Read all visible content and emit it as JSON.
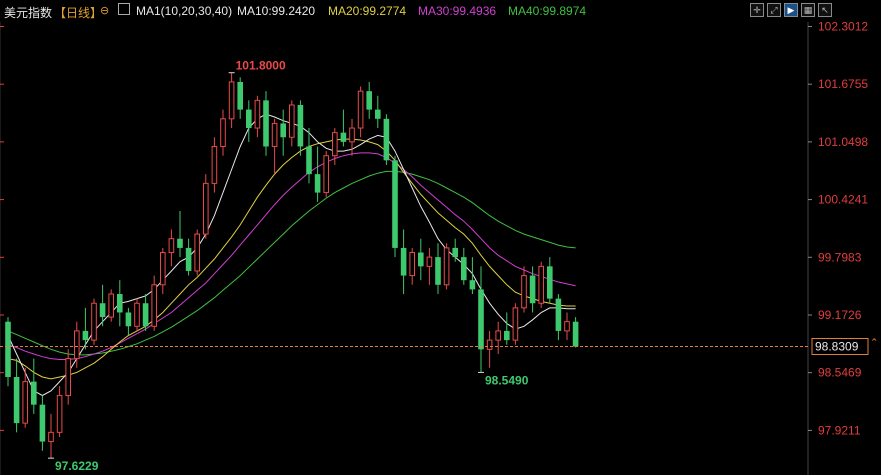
{
  "header": {
    "title": "美元指数",
    "period": "【日线】",
    "ma_group": "MA1(10,20,30,40)",
    "ma10": "MA10:99.2420",
    "ma20": "MA20:99.2774",
    "ma30": "MA30:99.4936",
    "ma40": "MA40:99.8974"
  },
  "colors": {
    "up": "#e84a4a",
    "down": "#3ec96e",
    "ma10": "#e8e8e8",
    "ma20": "#e0d040",
    "ma30": "#d040d0",
    "ma40": "#40c040",
    "current_line": "#e0803a"
  },
  "toolbar": {
    "icons": [
      "crosshair-icon",
      "expand-icon",
      "play-icon",
      "layout-icon",
      "cursor-icon"
    ]
  },
  "chart_data": {
    "type": "candlestick",
    "y_axis_labels": [
      "102.3012",
      "101.6755",
      "101.0498",
      "100.4241",
      "99.7983",
      "99.1726",
      "98.5469",
      "97.9211"
    ],
    "ylim": [
      97.6,
      102.35
    ],
    "current_price": "98.8309",
    "annotations": {
      "high": "101.8000",
      "low": "97.6229",
      "local_low": "98.5490"
    },
    "candles": [
      [
        99.1,
        99.15,
        98.4,
        98.5
      ],
      [
        98.5,
        98.7,
        97.9,
        98.0
      ],
      [
        98.0,
        98.6,
        97.95,
        98.45
      ],
      [
        98.45,
        98.7,
        98.1,
        98.2
      ],
      [
        98.2,
        98.3,
        97.7,
        97.8
      ],
      [
        97.8,
        98.1,
        97.62,
        97.9
      ],
      [
        97.9,
        98.4,
        97.85,
        98.3
      ],
      [
        98.3,
        98.8,
        98.2,
        98.7
      ],
      [
        98.7,
        99.1,
        98.6,
        99.0
      ],
      [
        99.0,
        99.25,
        98.8,
        98.9
      ],
      [
        98.9,
        99.35,
        98.85,
        99.3
      ],
      [
        99.3,
        99.5,
        99.05,
        99.15
      ],
      [
        99.15,
        99.45,
        99.1,
        99.4
      ],
      [
        99.4,
        99.55,
        99.05,
        99.2
      ],
      [
        99.2,
        99.25,
        98.95,
        99.05
      ],
      [
        99.05,
        99.35,
        99.0,
        99.3
      ],
      [
        99.3,
        99.4,
        99.0,
        99.05
      ],
      [
        99.05,
        99.6,
        99.0,
        99.5
      ],
      [
        99.5,
        99.9,
        99.4,
        99.85
      ],
      [
        99.85,
        100.1,
        99.7,
        100.0
      ],
      [
        100.0,
        100.3,
        99.8,
        99.9
      ],
      [
        99.9,
        100.0,
        99.6,
        99.65
      ],
      [
        99.65,
        100.1,
        99.6,
        100.05
      ],
      [
        100.05,
        100.7,
        100.0,
        100.6
      ],
      [
        100.6,
        101.1,
        100.5,
        101.0
      ],
      [
        101.0,
        101.4,
        100.9,
        101.3
      ],
      [
        101.3,
        101.8,
        101.2,
        101.7
      ],
      [
        101.7,
        101.75,
        101.3,
        101.4
      ],
      [
        101.4,
        101.5,
        101.05,
        101.2
      ],
      [
        101.2,
        101.55,
        101.1,
        101.5
      ],
      [
        101.5,
        101.6,
        100.9,
        101.0
      ],
      [
        101.0,
        101.3,
        100.7,
        101.25
      ],
      [
        101.25,
        101.4,
        100.9,
        101.1
      ],
      [
        101.1,
        101.5,
        101.0,
        101.45
      ],
      [
        101.45,
        101.5,
        100.9,
        101.0
      ],
      [
        101.0,
        101.2,
        100.6,
        100.7
      ],
      [
        100.7,
        101.0,
        100.4,
        100.5
      ],
      [
        100.5,
        100.95,
        100.45,
        100.9
      ],
      [
        100.9,
        101.2,
        100.8,
        101.15
      ],
      [
        101.15,
        101.4,
        101.0,
        101.05
      ],
      [
        101.05,
        101.3,
        100.9,
        101.2
      ],
      [
        101.2,
        101.65,
        101.1,
        101.6
      ],
      [
        101.6,
        101.7,
        101.3,
        101.4
      ],
      [
        101.4,
        101.55,
        101.2,
        101.3
      ],
      [
        101.3,
        101.35,
        100.8,
        100.85
      ],
      [
        100.85,
        100.9,
        99.8,
        99.9
      ],
      [
        99.9,
        100.1,
        99.4,
        99.6
      ],
      [
        99.6,
        99.9,
        99.5,
        99.85
      ],
      [
        99.85,
        100.0,
        99.55,
        99.7
      ],
      [
        99.7,
        99.9,
        99.5,
        99.8
      ],
      [
        99.8,
        99.95,
        99.4,
        99.5
      ],
      [
        99.5,
        99.95,
        99.45,
        99.9
      ],
      [
        99.9,
        100.0,
        99.75,
        99.8
      ],
      [
        99.8,
        99.9,
        99.5,
        99.55
      ],
      [
        99.55,
        99.8,
        99.4,
        99.45
      ],
      [
        99.45,
        99.7,
        98.55,
        98.8
      ],
      [
        98.8,
        99.0,
        98.6,
        98.9
      ],
      [
        98.9,
        99.1,
        98.75,
        99.0
      ],
      [
        99.0,
        99.2,
        98.85,
        98.9
      ],
      [
        98.9,
        99.3,
        98.85,
        99.25
      ],
      [
        99.25,
        99.7,
        99.2,
        99.6
      ],
      [
        99.6,
        99.7,
        99.2,
        99.3
      ],
      [
        99.3,
        99.75,
        99.25,
        99.7
      ],
      [
        99.7,
        99.8,
        99.3,
        99.35
      ],
      [
        99.35,
        99.4,
        98.9,
        99.0
      ],
      [
        99.0,
        99.2,
        98.9,
        99.1
      ],
      [
        99.1,
        99.15,
        98.82,
        98.83
      ]
    ],
    "ma10": [
      98.95,
      98.75,
      98.55,
      98.35,
      98.3,
      98.35,
      98.45,
      98.55,
      98.7,
      98.85,
      99.0,
      99.1,
      99.2,
      99.3,
      99.32,
      99.35,
      99.38,
      99.45,
      99.55,
      99.65,
      99.75,
      99.8,
      99.9,
      100.05,
      100.25,
      100.5,
      100.75,
      101.0,
      101.2,
      101.3,
      101.35,
      101.32,
      101.28,
      101.25,
      101.22,
      101.15,
      101.05,
      100.98,
      100.95,
      100.95,
      100.97,
      101.02,
      101.08,
      101.12,
      101.1,
      100.95,
      100.75,
      100.55,
      100.35,
      100.18,
      100.0,
      99.88,
      99.8,
      99.72,
      99.62,
      99.45,
      99.3,
      99.18,
      99.08,
      99.02,
      99.05,
      99.12,
      99.2,
      99.25,
      99.25,
      99.24,
      99.24
    ],
    "ma20": [
      98.7,
      98.68,
      98.62,
      98.55,
      98.5,
      98.48,
      98.5,
      98.52,
      98.55,
      98.6,
      98.65,
      98.72,
      98.8,
      98.88,
      98.95,
      99.0,
      99.05,
      99.12,
      99.2,
      99.3,
      99.4,
      99.5,
      99.58,
      99.68,
      99.78,
      99.9,
      100.02,
      100.15,
      100.3,
      100.45,
      100.58,
      100.7,
      100.8,
      100.88,
      100.95,
      101.0,
      101.03,
      101.05,
      101.07,
      101.08,
      101.08,
      101.07,
      101.05,
      101.02,
      100.95,
      100.85,
      100.72,
      100.6,
      100.48,
      100.38,
      100.28,
      100.2,
      100.12,
      100.05,
      99.95,
      99.82,
      99.7,
      99.6,
      99.5,
      99.42,
      99.38,
      99.35,
      99.32,
      99.3,
      99.28,
      99.27,
      99.27
    ],
    "ma30": [
      98.85,
      98.82,
      98.78,
      98.75,
      98.72,
      98.7,
      98.69,
      98.69,
      98.7,
      98.72,
      98.75,
      98.78,
      98.82,
      98.87,
      98.92,
      98.97,
      99.02,
      99.08,
      99.14,
      99.2,
      99.28,
      99.36,
      99.44,
      99.52,
      99.62,
      99.72,
      99.82,
      99.93,
      100.04,
      100.15,
      100.26,
      100.37,
      100.47,
      100.56,
      100.64,
      100.72,
      100.78,
      100.83,
      100.87,
      100.9,
      100.92,
      100.93,
      100.93,
      100.92,
      100.88,
      100.82,
      100.75,
      100.67,
      100.58,
      100.5,
      100.42,
      100.34,
      100.26,
      100.19,
      100.1,
      100.0,
      99.9,
      99.82,
      99.76,
      99.7,
      99.66,
      99.62,
      99.59,
      99.56,
      99.53,
      99.51,
      99.49
    ],
    "ma40": [
      99.0,
      98.96,
      98.92,
      98.88,
      98.84,
      98.8,
      98.77,
      98.75,
      98.74,
      98.74,
      98.75,
      98.76,
      98.78,
      98.8,
      98.83,
      98.86,
      98.9,
      98.94,
      98.99,
      99.04,
      99.1,
      99.16,
      99.22,
      99.29,
      99.36,
      99.44,
      99.52,
      99.6,
      99.69,
      99.78,
      99.87,
      99.96,
      100.05,
      100.14,
      100.22,
      100.3,
      100.37,
      100.44,
      100.5,
      100.55,
      100.6,
      100.64,
      100.68,
      100.71,
      100.73,
      100.73,
      100.72,
      100.7,
      100.67,
      100.64,
      100.6,
      100.55,
      100.5,
      100.45,
      100.39,
      100.32,
      100.25,
      100.19,
      100.14,
      100.09,
      100.05,
      100.02,
      99.99,
      99.96,
      99.93,
      99.91,
      99.9
    ]
  }
}
